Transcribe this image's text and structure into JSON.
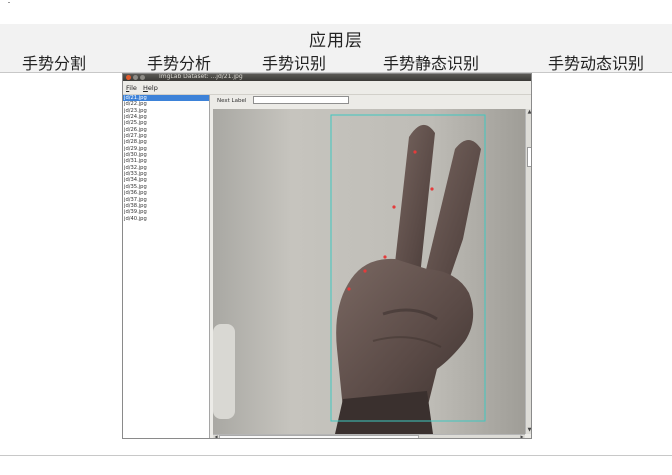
{
  "header": {
    "layer_title": "应用层",
    "categories": [
      "手势分割",
      "手势分析",
      "手势识别",
      "手势静态识别",
      "手势动态识别"
    ]
  },
  "app": {
    "window_title": "ImgLab Dataset: ...jd/21.jpg",
    "menu": [
      "File",
      "Help"
    ],
    "next_label": "Next Label",
    "next_label_value": "",
    "files": [
      "jd/21.jpg",
      "jd/22.jpg",
      "jd/23.jpg",
      "jd/24.jpg",
      "jd/25.jpg",
      "jd/26.jpg",
      "jd/27.jpg",
      "jd/28.jpg",
      "jd/29.jpg",
      "jd/30.jpg",
      "jd/31.jpg",
      "jd/32.jpg",
      "jd/33.jpg",
      "jd/34.jpg",
      "jd/35.jpg",
      "jd/36.jpg",
      "jd/37.jpg",
      "jd/38.jpg",
      "jd/39.jpg",
      "jd/40.jpg"
    ],
    "selected_file_index": 0
  },
  "colors": {
    "bounding_box": "#3fc8c0",
    "landmark": "#e43b3b",
    "selection": "#3d82d8"
  },
  "icons": {
    "close": "close-icon",
    "minimize": "minimize-icon",
    "maximize": "maximize-icon",
    "scroll_up": "arrow-up-icon",
    "scroll_down": "arrow-down-icon",
    "scroll_left": "arrow-left-icon",
    "scroll_right": "arrow-right-icon"
  }
}
